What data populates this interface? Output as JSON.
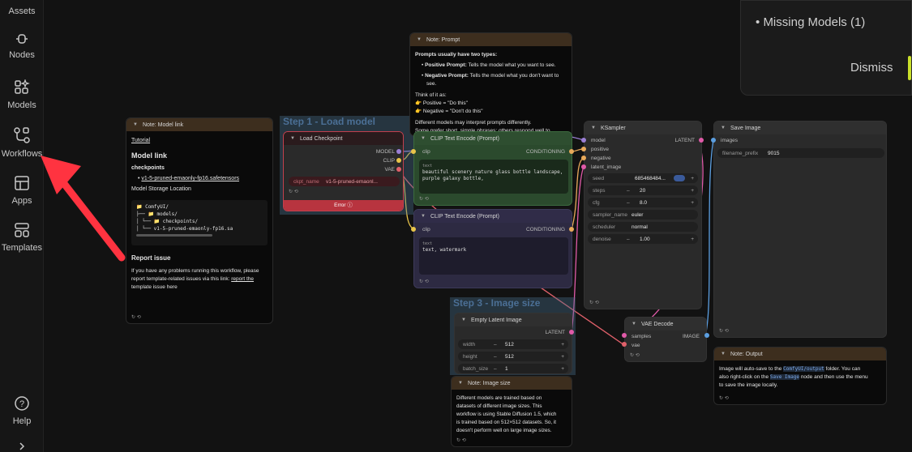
{
  "sidebar": {
    "items": [
      {
        "label": "Assets",
        "icon": "assets-icon"
      },
      {
        "label": "Nodes",
        "icon": "nodes-icon"
      },
      {
        "label": "Models",
        "icon": "models-icon"
      },
      {
        "label": "Workflows",
        "icon": "workflows-icon"
      },
      {
        "label": "Apps",
        "icon": "apps-icon"
      },
      {
        "label": "Templates",
        "icon": "templates-icon"
      }
    ],
    "help_label": "Help"
  },
  "groups": {
    "step1": "Step 1 - Load model",
    "step3": "Step 3 - Image size"
  },
  "note_model_link": {
    "title": "Note: Model link",
    "tutorial": "Tutorial",
    "heading": "Model link",
    "checkpoints_label": "checkpoints",
    "checkpoint_file": "v1-5-pruned-emaonly-fp16.safetensors",
    "storage_label": "Model Storage Location",
    "tree_1": "📁 ComfyUI/",
    "tree_2": "├── 📁 models/",
    "tree_3": "│   └── 📁 checkpoints/",
    "tree_4": "│       └── v1-5-pruned-emaonly-fp16.sa",
    "report_heading": "Report issue",
    "report_text_1": "If you have any problems running this workflow, please",
    "report_text_2": "report template-related issues via this link:",
    "report_link": "report the",
    "report_text_3": "template issue here"
  },
  "note_prompt": {
    "title": "Note: Prompt",
    "intro": "Prompts usually have two types:",
    "positive_label": "Positive Prompt:",
    "positive_text": "Tells the model what you want to see.",
    "negative_label": "Negative Prompt:",
    "negative_text": "Tells the model what you don't want to",
    "negative_text_2": "see.",
    "think": "Think of it as:",
    "pos_example": "👉 Positive = \"Do this\"",
    "neg_example": "👉 Negative = \"Don't do this\"",
    "diff_1": "Different models may interpret prompts differently.",
    "diff_2": "Some prefer short, simple phrases; others respond well to"
  },
  "load_checkpoint": {
    "title": "Load Checkpoint",
    "out_model": "MODEL",
    "out_clip": "CLIP",
    "out_vae": "VAE",
    "ckpt_label": "ckpt_name",
    "ckpt_value": "v1-5-pruned-emaonl...",
    "error_label": "Error"
  },
  "clip_pos": {
    "title": "CLIP Text Encode (Prompt)",
    "in_clip": "clip",
    "out": "CONDITIONING",
    "text_label": "text",
    "text": "beautiful scenery nature glass bottle landscape, purple galaxy bottle,"
  },
  "clip_neg": {
    "title": "CLIP Text Encode (Prompt)",
    "in_clip": "clip",
    "out": "CONDITIONING",
    "text_label": "text",
    "text": "text, watermark"
  },
  "ksampler": {
    "title": "KSampler",
    "in_model": "model",
    "in_positive": "positive",
    "in_negative": "negative",
    "in_latent": "latent_image",
    "out_latent": "LATENT",
    "seed_label": "seed",
    "seed_value": "685468484...",
    "steps_label": "steps",
    "steps_value": "20",
    "cfg_label": "cfg",
    "cfg_value": "8.0",
    "sampler_label": "sampler_name",
    "sampler_value": "euler",
    "scheduler_label": "scheduler",
    "scheduler_value": "normal",
    "denoise_label": "denoise",
    "denoise_value": "1.00"
  },
  "save_image": {
    "title": "Save Image",
    "in_images": "images",
    "prefix_label": "filename_prefix",
    "prefix_value": "9015"
  },
  "empty_latent": {
    "title": "Empty Latent Image",
    "out": "LATENT",
    "width_label": "width",
    "width_value": "512",
    "height_label": "height",
    "height_value": "512",
    "batch_label": "batch_size",
    "batch_value": "1"
  },
  "vae_decode": {
    "title": "VAE Decode",
    "in_samples": "samples",
    "in_vae": "vae",
    "out": "IMAGE"
  },
  "note_output": {
    "title": "Note: Output",
    "line1_a": "Image will auto-save to the",
    "line1_code": "ComfyUI/output",
    "line1_b": "folder. You can",
    "line2_a": "also right-click on the",
    "line2_code": "Save Image",
    "line2_b": "node and then use the menu",
    "line3": "to save the image locally."
  },
  "note_image_size": {
    "title": "Note: Image size",
    "l1": "Different models are trained based on",
    "l2": "datasets of different image sizes. This",
    "l3": "workflow is using Stable Diffusion 1.5, which",
    "l4": "is trained based on 512×512 datasets. So, it",
    "l5": "doesn't perform well on large image sizes."
  },
  "modal": {
    "missing_models": "Missing Models (1)",
    "dismiss": "Dismiss"
  },
  "colors": {
    "accent_pink": "#e05aa8",
    "clip_yellow": "#e8c44a",
    "vae_red": "#e0606a",
    "group_blue": "#4b6f95",
    "arrow_red": "#ff3340"
  }
}
